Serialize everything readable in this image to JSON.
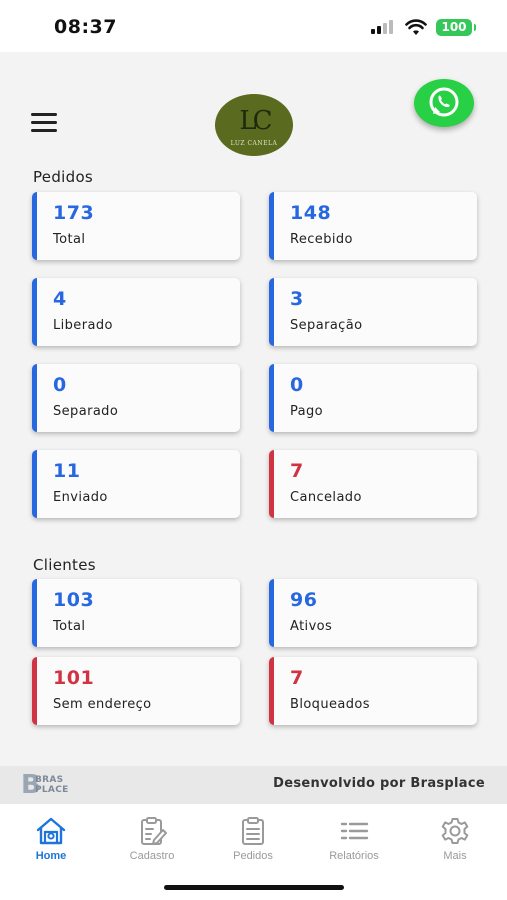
{
  "status_bar": {
    "time": "08:37",
    "battery": "100"
  },
  "header": {
    "logo_text": "LUZ CANELA",
    "logo_mark": "LC"
  },
  "pedidos": {
    "title": "Pedidos",
    "cards": [
      {
        "value": "173",
        "label": "Total",
        "color": "blue"
      },
      {
        "value": "148",
        "label": "Recebido",
        "color": "blue"
      },
      {
        "value": "4",
        "label": "Liberado",
        "color": "blue"
      },
      {
        "value": "3",
        "label": "Separação",
        "color": "blue"
      },
      {
        "value": "0",
        "label": "Separado",
        "color": "blue"
      },
      {
        "value": "0",
        "label": "Pago",
        "color": "blue"
      },
      {
        "value": "11",
        "label": "Enviado",
        "color": "blue"
      },
      {
        "value": "7",
        "label": "Cancelado",
        "color": "red"
      }
    ]
  },
  "clientes": {
    "title": "Clientes",
    "cards": [
      {
        "value": "103",
        "label": "Total",
        "color": "blue"
      },
      {
        "value": "96",
        "label": "Ativos",
        "color": "blue"
      },
      {
        "value": "101",
        "label": "Sem endereço",
        "color": "red"
      },
      {
        "value": "7",
        "label": "Bloqueados",
        "color": "red"
      }
    ]
  },
  "footer": {
    "brand_logo": {
      "letter": "B",
      "line1": "BRAS",
      "line2": "PLACE"
    },
    "developed_by": "Desenvolvido por Brasplace"
  },
  "tab_bar": {
    "tabs": [
      {
        "label": "Home",
        "icon": "home-icon",
        "active": true
      },
      {
        "label": "Cadastro",
        "icon": "clipboard-edit-icon",
        "active": false
      },
      {
        "label": "Pedidos",
        "icon": "clipboard-list-icon",
        "active": false
      },
      {
        "label": "Relatórios",
        "icon": "list-icon",
        "active": false
      },
      {
        "label": "Mais",
        "icon": "gear-icon",
        "active": false
      }
    ]
  },
  "colors": {
    "blue": "#2767e0",
    "red": "#d03341",
    "tab_active": "#1e74d8",
    "whatsapp": "#27d045"
  }
}
